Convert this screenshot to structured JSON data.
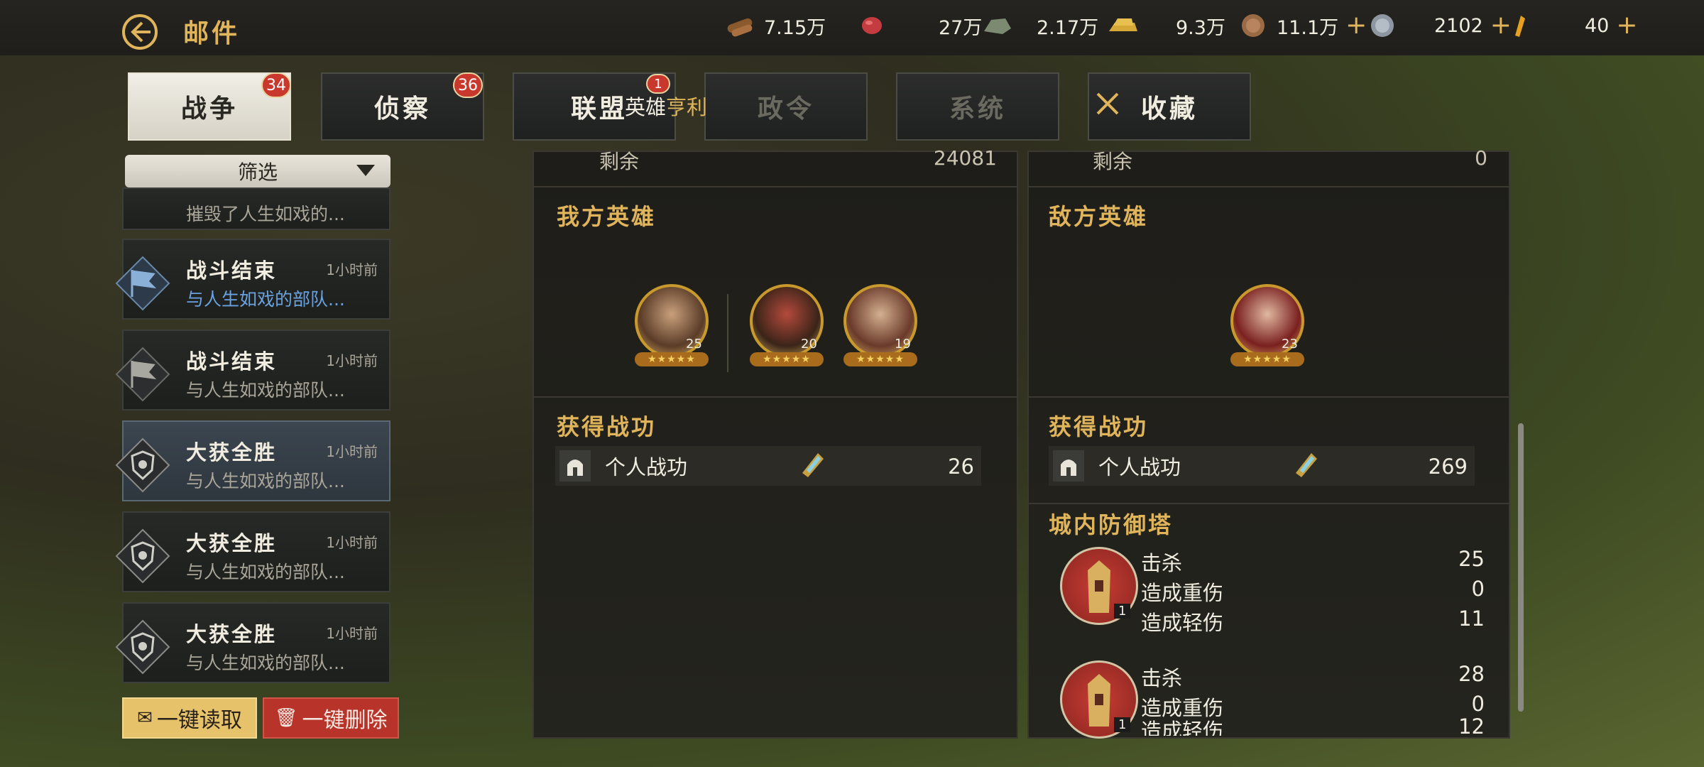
{
  "header": {
    "title": "邮件"
  },
  "resources": [
    {
      "icon": "wood-icon",
      "value": "7.15万",
      "plus": false
    },
    {
      "icon": "meat-icon",
      "value": "27万",
      "plus": false
    },
    {
      "icon": "stone-icon",
      "value": "2.17万",
      "plus": false
    },
    {
      "icon": "gold-bar-icon",
      "value": "9.3万",
      "plus": false
    },
    {
      "icon": "bronze-coin-icon",
      "value": "11.1万",
      "plus": true
    },
    {
      "icon": "silver-coin-icon",
      "value": "2102",
      "plus": true
    },
    {
      "icon": "gem-icon",
      "value": "40",
      "plus": true
    }
  ],
  "plus_label": "+",
  "tabs": [
    {
      "label": "战争",
      "badge": "34",
      "active": true
    },
    {
      "label": "侦察",
      "badge": "36",
      "active": false
    },
    {
      "label": "联盟",
      "badge": "1",
      "active": false
    },
    {
      "label": "政令",
      "badge": "",
      "active": false
    },
    {
      "label": "系统",
      "badge": "",
      "active": false
    },
    {
      "label": "收藏",
      "badge": "",
      "active": false
    }
  ],
  "hero_strip": {
    "prefix": "英雄",
    "highlight": "亨利"
  },
  "filter": {
    "label": "筛选"
  },
  "mail_partial": {
    "subtitle": "摧毁了人生如戏的..."
  },
  "mails": [
    {
      "title": "战斗结束",
      "time": "1小时前",
      "subtitle": "与人生如戏的部队...",
      "icon": "battle-flag-icon",
      "unread": true,
      "selected": false
    },
    {
      "title": "战斗结束",
      "time": "1小时前",
      "subtitle": "与人生如戏的部队...",
      "icon": "battle-flag-icon",
      "unread": false,
      "selected": false
    },
    {
      "title": "大获全胜",
      "time": "1小时前",
      "subtitle": "与人生如戏的部队...",
      "icon": "victory-crest-icon",
      "unread": false,
      "selected": true
    },
    {
      "title": "大获全胜",
      "time": "1小时前",
      "subtitle": "与人生如戏的部队...",
      "icon": "victory-crest-icon",
      "unread": false,
      "selected": false
    },
    {
      "title": "大获全胜",
      "time": "1小时前",
      "subtitle": "与人生如戏的部队...",
      "icon": "victory-crest-icon",
      "unread": false,
      "selected": false
    }
  ],
  "actions": {
    "read_all": "一键读取",
    "delete_all": "一键删除"
  },
  "left_panel": {
    "remaining_label": "剩余",
    "remaining_value": "24081",
    "heroes_title": "我方英雄",
    "heroes": [
      {
        "level": "25",
        "name": "hero-portrait-woman"
      },
      {
        "level": "20",
        "name": "hero-portrait-samurai"
      },
      {
        "level": "19",
        "name": "hero-portrait-laurel"
      }
    ],
    "merit_title": "获得战功",
    "merit_label": "个人战功",
    "merit_value": "26"
  },
  "right_panel": {
    "remaining_label": "剩余",
    "remaining_value": "0",
    "heroes_title": "敌方英雄",
    "heroes": [
      {
        "level": "23",
        "name": "hero-portrait-lady"
      }
    ],
    "merit_title": "获得战功",
    "merit_label": "个人战功",
    "merit_value": "269",
    "tower_title": "城内防御塔",
    "towers": [
      {
        "level": "1",
        "stats": [
          {
            "label": "击杀",
            "value": "25"
          },
          {
            "label": "造成重伤",
            "value": "0"
          },
          {
            "label": "造成轻伤",
            "value": "11"
          }
        ]
      },
      {
        "level": "1",
        "stats": [
          {
            "label": "击杀",
            "value": "28"
          },
          {
            "label": "造成重伤",
            "value": "0"
          },
          {
            "label": "造成轻伤",
            "value": "12"
          }
        ]
      }
    ]
  },
  "stars": "★★★★★",
  "colors": {
    "gold": "#e0b45a",
    "badge_red": "#c9382c",
    "delete_red": "#b8332a",
    "read_yellow": "#e6c26a"
  }
}
